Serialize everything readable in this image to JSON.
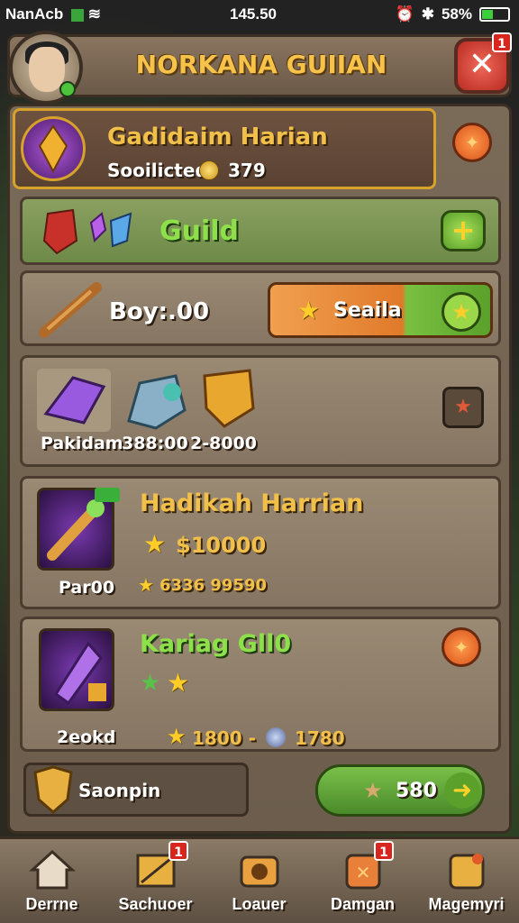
{
  "status_bar": {
    "left_text": "NanAcb",
    "time": "145.50",
    "battery": "58%"
  },
  "header": {
    "title": "NORKANA GUIIAN",
    "close_badge": "1"
  },
  "daily_banner": {
    "title": "Gadidaim Harian",
    "label": "Sooilicted",
    "value": "379"
  },
  "guild_row": {
    "label": "Guild",
    "add_symbol": "+"
  },
  "boy_row": {
    "label": "Boy:.00",
    "button_label": "Seaila"
  },
  "items_row": {
    "items": [
      {
        "label": "Pakidam"
      },
      {
        "label": "388:00"
      },
      {
        "label": "2-8000"
      }
    ]
  },
  "quest1": {
    "title": "Hadikah Harrian",
    "reward": "$10000",
    "item_label": "Par00",
    "sub": "6336 99590"
  },
  "quest2": {
    "title": "Kariag Gll0",
    "item_label": "2eokd",
    "reward1": "1800 -",
    "reward2": "1780"
  },
  "action_row": {
    "label": "Saonpin",
    "button_value": "580"
  },
  "nav": {
    "items": [
      {
        "label": "Derrne",
        "badge": ""
      },
      {
        "label": "Sachuoer",
        "badge": "1"
      },
      {
        "label": "Loauer",
        "badge": ""
      },
      {
        "label": "Damgan",
        "badge": "1"
      },
      {
        "label": "Magemyri",
        "badge": ""
      }
    ]
  },
  "colors": {
    "gold": "#f1c04a",
    "green": "#8ee04a",
    "orange": "#e86a2a",
    "red_badge": "#d8261e"
  }
}
